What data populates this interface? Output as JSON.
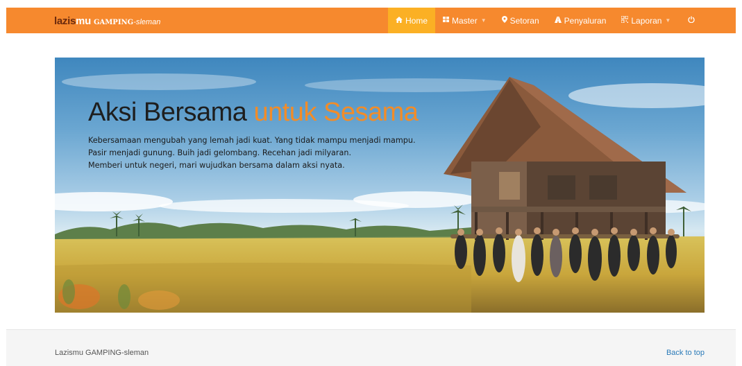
{
  "brand": {
    "part1": "lazis",
    "part2": "mu",
    "place_caps": "GAMPING",
    "place_suffix": "-sleman"
  },
  "nav": {
    "items": [
      {
        "label": "Home",
        "icon": "home-icon",
        "active": true
      },
      {
        "label": "Master",
        "icon": "grid-icon",
        "dropdown": true
      },
      {
        "label": "Setoran",
        "icon": "map-marker-icon"
      },
      {
        "label": "Penyaluran",
        "icon": "road-icon"
      },
      {
        "label": "Laporan",
        "icon": "qrcode-icon",
        "dropdown": true
      },
      {
        "label": "",
        "icon": "power-icon"
      }
    ]
  },
  "hero": {
    "title_main": "Aksi Bersama ",
    "title_accent": "untuk Sesama",
    "lines": [
      "Kebersamaan mengubah yang lemah jadi kuat. Yang tidak mampu menjadi mampu.",
      "Pasir menjadi gunung. Buih jadi gelombang. Recehan jadi milyaran.",
      "Memberi untuk negeri, mari wujudkan bersama dalam aksi nyata."
    ]
  },
  "footer": {
    "left": "Lazismu GAMPING-sleman",
    "right": "Back to top"
  },
  "colors": {
    "navbar": "#f6892e",
    "active": "#fbb024",
    "accent": "#f28c28",
    "link": "#2a7ab8"
  }
}
